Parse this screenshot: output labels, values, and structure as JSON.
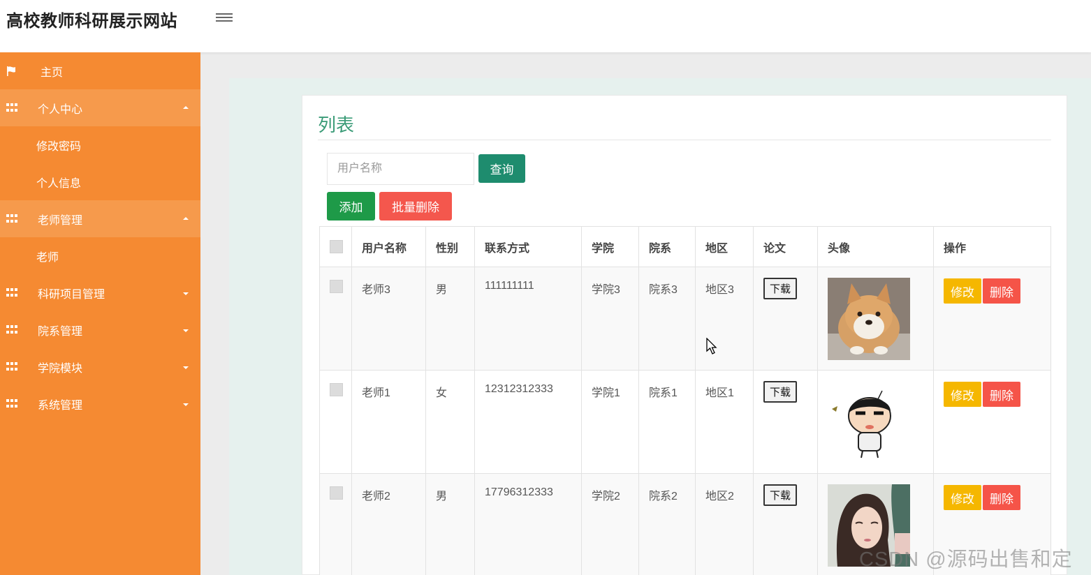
{
  "header": {
    "title": "高校教师科研展示网站",
    "menu_icon": "hamburger-icon"
  },
  "sidebar": {
    "items": [
      {
        "label": "主页",
        "icon": "flag-icon"
      },
      {
        "label": "个人中心",
        "icon": "grid-icon",
        "expanded": true,
        "children": [
          "修改密码",
          "个人信息"
        ]
      },
      {
        "label": "老师管理",
        "icon": "grid-icon",
        "expanded": true,
        "children": [
          "老师"
        ]
      },
      {
        "label": "科研项目管理",
        "icon": "grid-icon",
        "expanded": false
      },
      {
        "label": "院系管理",
        "icon": "grid-icon",
        "expanded": false
      },
      {
        "label": "学院模块",
        "icon": "grid-icon",
        "expanded": false
      },
      {
        "label": "系统管理",
        "icon": "grid-icon",
        "expanded": false
      }
    ]
  },
  "main": {
    "title": "列表",
    "search": {
      "placeholder": "用户名称",
      "value": ""
    },
    "buttons": {
      "query": "查询",
      "add": "添加",
      "batch_delete": "批量删除"
    },
    "table": {
      "columns": [
        "用户名称",
        "性别",
        "联系方式",
        "学院",
        "院系",
        "地区",
        "论文",
        "头像",
        "操作"
      ],
      "rows": [
        {
          "name": "老师3",
          "gender": "男",
          "phone": "111111111",
          "college": "学院3",
          "dept": "院系3",
          "region": "地区3",
          "paper": "下载",
          "avatar": "shiba-dog-photo",
          "edit": "修改",
          "delete": "删除"
        },
        {
          "name": "老师1",
          "gender": "女",
          "phone": "12312312333",
          "college": "学院1",
          "dept": "院系1",
          "region": "地区1",
          "paper": "下载",
          "avatar": "cartoon-boy-drawing",
          "edit": "修改",
          "delete": "删除"
        },
        {
          "name": "老师2",
          "gender": "男",
          "phone": "17796312333",
          "college": "学院2",
          "dept": "院系2",
          "region": "地区2",
          "paper": "下载",
          "avatar": "illustrated-woman-portrait",
          "edit": "修改",
          "delete": "删除"
        }
      ]
    }
  },
  "watermark": "CSDN @源码出售和定制",
  "colors": {
    "sidebar": "#f58a32",
    "accent_green": "#1e8c6e",
    "danger": "#f4574d",
    "warning": "#f5b700"
  }
}
